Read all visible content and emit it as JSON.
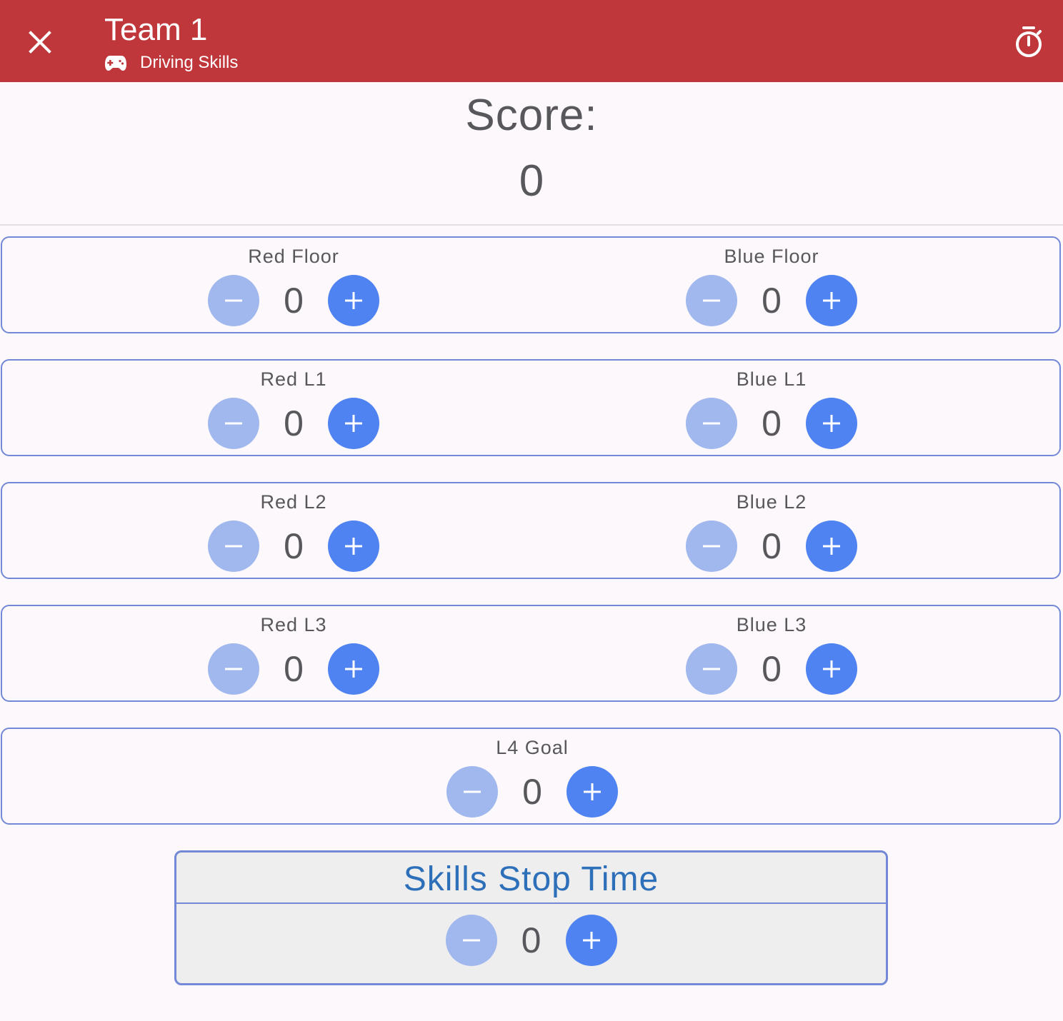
{
  "header": {
    "title": "Team 1",
    "subtitle": "Driving Skills",
    "close_icon": "close-icon",
    "mode_icon": "gamepad-icon",
    "timer_icon": "timer-icon",
    "bar_color": "#c0373b"
  },
  "score": {
    "label": "Score:",
    "value": "0"
  },
  "rows": [
    {
      "left": {
        "label": "Red Floor",
        "value": "0"
      },
      "right": {
        "label": "Blue Floor",
        "value": "0"
      }
    },
    {
      "left": {
        "label": "Red L1",
        "value": "0"
      },
      "right": {
        "label": "Blue L1",
        "value": "0"
      }
    },
    {
      "left": {
        "label": "Red L2",
        "value": "0"
      },
      "right": {
        "label": "Blue L2",
        "value": "0"
      }
    },
    {
      "left": {
        "label": "Red L3",
        "value": "0"
      },
      "right": {
        "label": "Blue L3",
        "value": "0"
      }
    }
  ],
  "goal": {
    "label": "L4 Goal",
    "value": "0"
  },
  "stop_time": {
    "label": "Skills Stop Time",
    "value": "0"
  },
  "colors": {
    "minus_button": "#a0b8ee",
    "plus_button": "#4f83f1",
    "card_border": "#7388d6",
    "stop_title": "#2e6fba"
  }
}
